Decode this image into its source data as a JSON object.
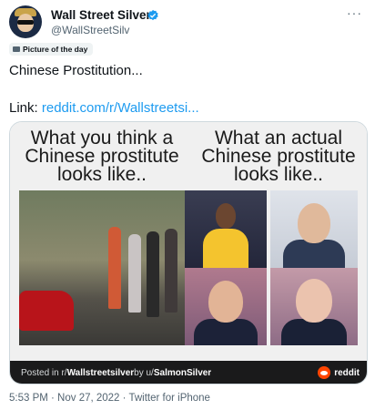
{
  "tweet": {
    "author_name": "Wall Street Silver",
    "author_handle": "@WallStreetSilv",
    "more_icon": "ellipsis-icon",
    "verified_icon": "verified-badge-icon",
    "label": "Picture of the day",
    "text_line1": "Chinese Prostitution...",
    "link_prefix": "Link: ",
    "link_text": "reddit.com/r/Wallstreetsi...",
    "timestamp": "5:53 PM · Nov 27, 2022 · Twitter for iPhone",
    "accent": "#1d9bf0"
  },
  "media": {
    "caption_left": "What you think a Chinese prostitute looks like..",
    "caption_right": "What an actual Chinese prostitute looks like..",
    "footer_prefix": "Posted in r/",
    "subreddit": "Wallstreetsilver",
    "footer_by": " by u/",
    "username": "SalmonSilver",
    "brand": "reddit",
    "brand_color": "#ff4500"
  }
}
